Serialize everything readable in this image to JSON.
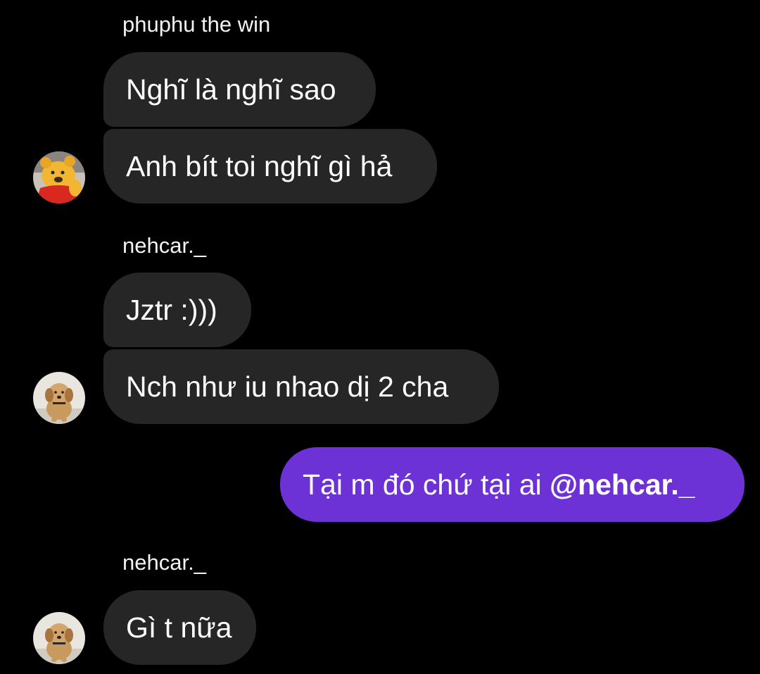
{
  "conversation": {
    "groups": [
      {
        "sender": "phuphu the win",
        "avatar_icon": "winnie-the-pooh-avatar-icon",
        "messages": [
          "Nghĩ là nghĩ sao",
          "Anh bít toi nghĩ gì hả"
        ]
      },
      {
        "sender": "nehcar._",
        "avatar_icon": "puppy-avatar-icon",
        "messages": [
          "Jztr :)))",
          "Nch như iu nhao dị 2 cha"
        ]
      },
      {
        "outgoing": true,
        "text": "Tại m đó chứ tại ai ",
        "mention": "@nehcar._"
      },
      {
        "sender": "nehcar._",
        "avatar_icon": "puppy-avatar-icon",
        "messages": [
          "Gì t nữa"
        ]
      }
    ]
  },
  "colors": {
    "background": "#000000",
    "incoming_bubble": "#262626",
    "outgoing_bubble": "#6d32d5",
    "text": "#ffffff"
  }
}
